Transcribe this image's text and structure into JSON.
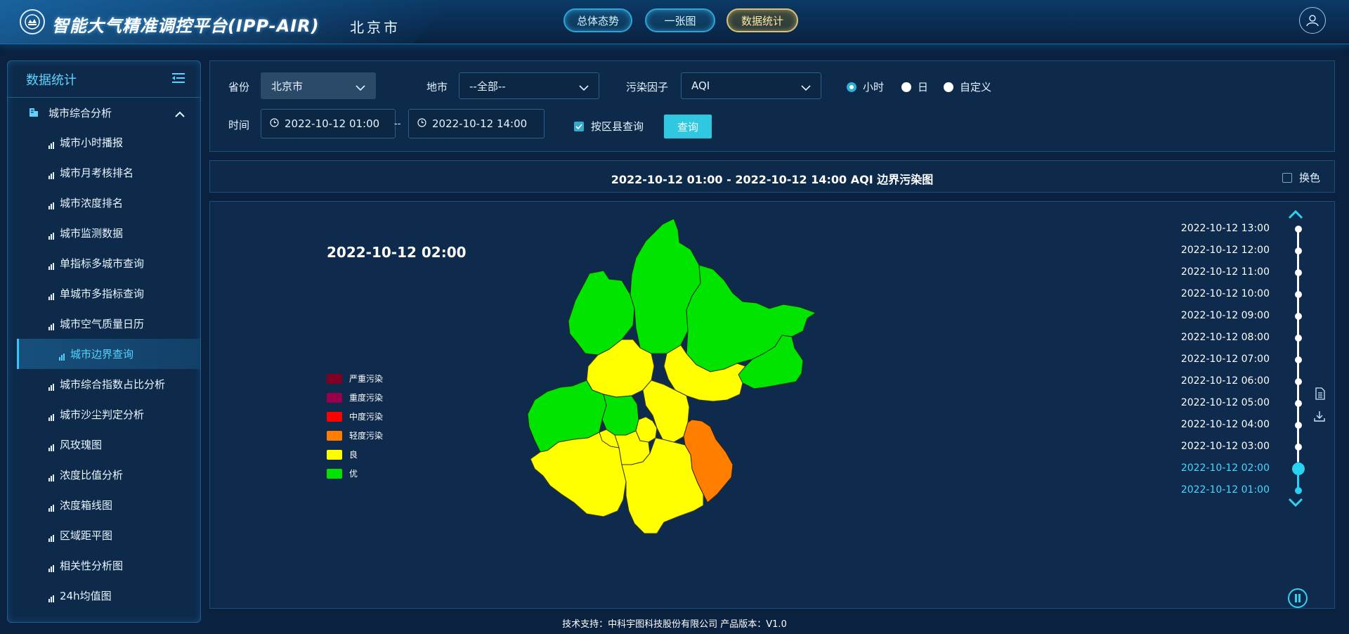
{
  "header": {
    "app_title": "智能大气精准调控平台(IPP-AIR)",
    "city": "北京市",
    "nav": [
      {
        "label": "总体态势",
        "active": false
      },
      {
        "label": "一张图",
        "active": false
      },
      {
        "label": "数据统计",
        "active": true
      }
    ]
  },
  "sidebar": {
    "title": "数据统计",
    "group": "城市综合分析",
    "items": [
      "城市小时播报",
      "城市月考核排名",
      "城市浓度排名",
      "城市监测数据",
      "单指标多城市查询",
      "单城市多指标查询",
      "城市空气质量日历",
      "城市边界查询",
      "城市综合指数占比分析",
      "城市沙尘判定分析",
      "风玫瑰图",
      "浓度比值分析",
      "浓度箱线图",
      "区域距平图",
      "相关性分析图",
      "24h均值图"
    ],
    "active_index": 7
  },
  "filter": {
    "province_label": "省份",
    "province_value": "北京市",
    "city_label": "地市",
    "city_value": "--全部--",
    "pollutant_label": "污染因子",
    "pollutant_value": "AQI",
    "granularity": {
      "hour": "小时",
      "day": "日",
      "custom": "自定义",
      "selected": "hour"
    },
    "time_label": "时间",
    "start_time": "2022-10-12 01:00",
    "range_sep": "--",
    "end_time": "2022-10-12 14:00",
    "district_query_label": "按区县查询",
    "district_query_checked": true,
    "query_button": "查询"
  },
  "titlebar": {
    "title": "2022-10-12 01:00 - 2022-10-12 14:00 AQI 边界污染图",
    "swap_color_label": "换色"
  },
  "map": {
    "current_time": "2022-10-12 02:00",
    "legend": [
      {
        "label": "严重污染",
        "color": "#7e0023"
      },
      {
        "label": "重度污染",
        "color": "#99004c"
      },
      {
        "label": "中度污染",
        "color": "#ff0000"
      },
      {
        "label": "轻度污染",
        "color": "#ff7e00"
      },
      {
        "label": "良",
        "color": "#ffff00"
      },
      {
        "label": "优",
        "color": "#00e400"
      }
    ]
  },
  "timeline": {
    "times": [
      "2022-10-12 13:00",
      "2022-10-12 12:00",
      "2022-10-12 11:00",
      "2022-10-12 10:00",
      "2022-10-12 09:00",
      "2022-10-12 08:00",
      "2022-10-12 07:00",
      "2022-10-12 06:00",
      "2022-10-12 05:00",
      "2022-10-12 04:00",
      "2022-10-12 03:00",
      "2022-10-12 02:00",
      "2022-10-12 01:00"
    ],
    "current_index": 11
  },
  "footer": {
    "text": "技术支持：中科宇图科技股份有限公司 产品版本：V1.0"
  }
}
